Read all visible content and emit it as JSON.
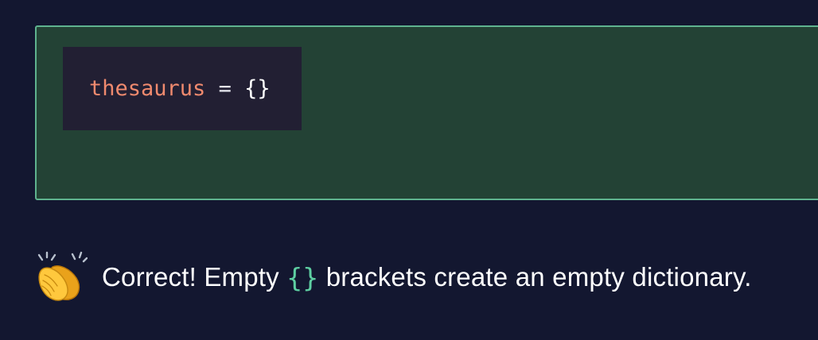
{
  "answer": {
    "code": {
      "variable": "thesaurus",
      "operator": " = ",
      "value": "{}"
    },
    "border_color": "#5fb38f",
    "background_color": "#234235"
  },
  "feedback": {
    "icon": "clapping-hands-icon",
    "text_before": "Correct! Empty ",
    "highlight": "{}",
    "text_after": " brackets create an empty dictionary.",
    "highlight_color": "#5ecfa2"
  }
}
